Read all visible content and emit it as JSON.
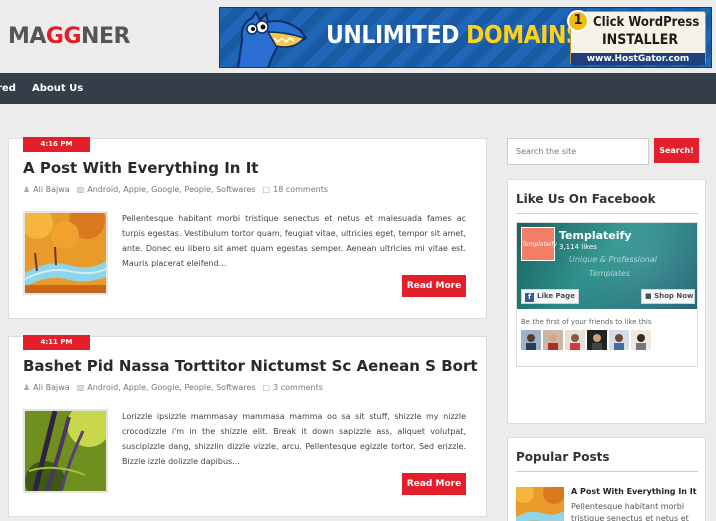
{
  "header": {
    "logo_text": "MAGGNER",
    "banner": {
      "line_white": "UNLIMITED",
      "line_yellow": "DOMAINS",
      "badge_number": "1",
      "badge_line1": "Click WordPress",
      "badge_line2": "INSTALLER",
      "url": "www.HostGator.com"
    }
  },
  "nav": {
    "items": [
      {
        "label": "red"
      },
      {
        "label": "About Us"
      }
    ]
  },
  "posts": [
    {
      "time": "4:16 PM",
      "title": "A Post With Everything In It",
      "author": "Ali Bajwa",
      "categories": "Android, Apple, Google, People, Softwares",
      "comments": "18 comments",
      "excerpt": "Pellentesque habitant morbi tristique senectus et netus et malesuada fames ac turpis egestas. Vestibulum tortor quam, feugiat vitae, ultricies eget, tempor sit amet, ante. Donec eu libero sit amet quam egestas semper. Aenean ultricies mi vitae est. Mauris placerat eleifend...",
      "read_more": "Read More"
    },
    {
      "time": "4:11 PM",
      "title": "Bashet Pid Nassa Torttitor Nictumst Sc Aenean S Bort",
      "author": "Ali Bajwa",
      "categories": "Android, Apple, Google, People, Softwares",
      "comments": "3 comments",
      "excerpt": "Lorizzle ipsizzle mammasay mammasa mamma oo sa sit stuff, shizzle my nizzle crocodizzle i'm in the shizzle elit. Break it down sapizzle ass, aliquet volutpat, suscipizzle dang, shizzlin dizzle vizzle, arcu. Pellentesque egizzle tortor. Sed erizzle. Bizzle izzle dolizzle dapibus...",
      "read_more": "Read More"
    }
  ],
  "sidebar": {
    "search": {
      "placeholder": "Search the site",
      "button": "Search!"
    },
    "facebook": {
      "title": "Like Us On Facebook",
      "page_logo": "Templateify",
      "page_name": "Templateify",
      "likes": "3,114 likes",
      "tagline1": "Unique & Professional",
      "tagline2": "Templates",
      "like_button": "Like Page",
      "shop_button": "Shop Now",
      "friends_text": "Be the first of your friends to like this"
    },
    "popular": {
      "title": "Popular Posts",
      "items": [
        {
          "title": "A Post With Everything In It",
          "excerpt": "Pellentesque habitant morbi tristique senectus et netus et"
        }
      ]
    }
  },
  "colors": {
    "accent": "#e21f2a",
    "nav_bg": "#333e48",
    "page_bg": "#ececec"
  }
}
